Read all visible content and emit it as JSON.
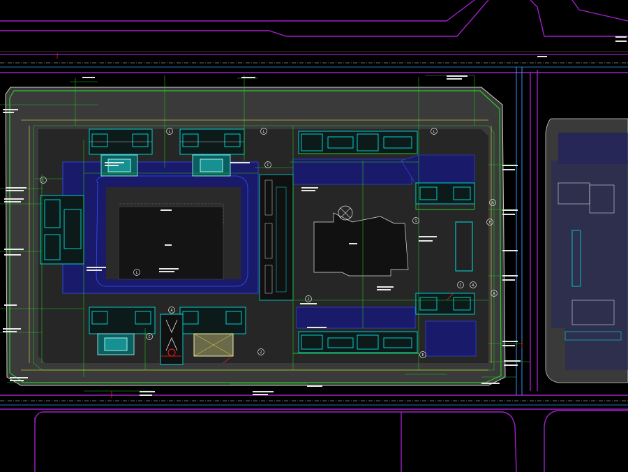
{
  "drawing": {
    "background": "#000000",
    "colors": {
      "road_edge": "#a020c8",
      "road_edge_light": "#d0d0d0",
      "boundary": "#2cc82c",
      "building": "#00e0e0",
      "dim_line": "#20c020",
      "paving": "#1a1a6a",
      "paving_edge": "#3050ff",
      "courtyard": "#2a2a2a",
      "hatch": "#3a3a3a",
      "text": "#e8e8e8",
      "accent_red": "#ff2020",
      "accent_yellow": "#ffff40",
      "grid_axis": "#2a9aff",
      "white_line": "#d8d8d8"
    }
  },
  "labels": {
    "axis_markers": [
      "L",
      "L",
      "L",
      "L",
      "C",
      "A",
      "A",
      "C",
      "A",
      "E",
      "E",
      "A",
      "C",
      "L",
      "1",
      "1",
      "2"
    ],
    "north_symbol": "N"
  }
}
